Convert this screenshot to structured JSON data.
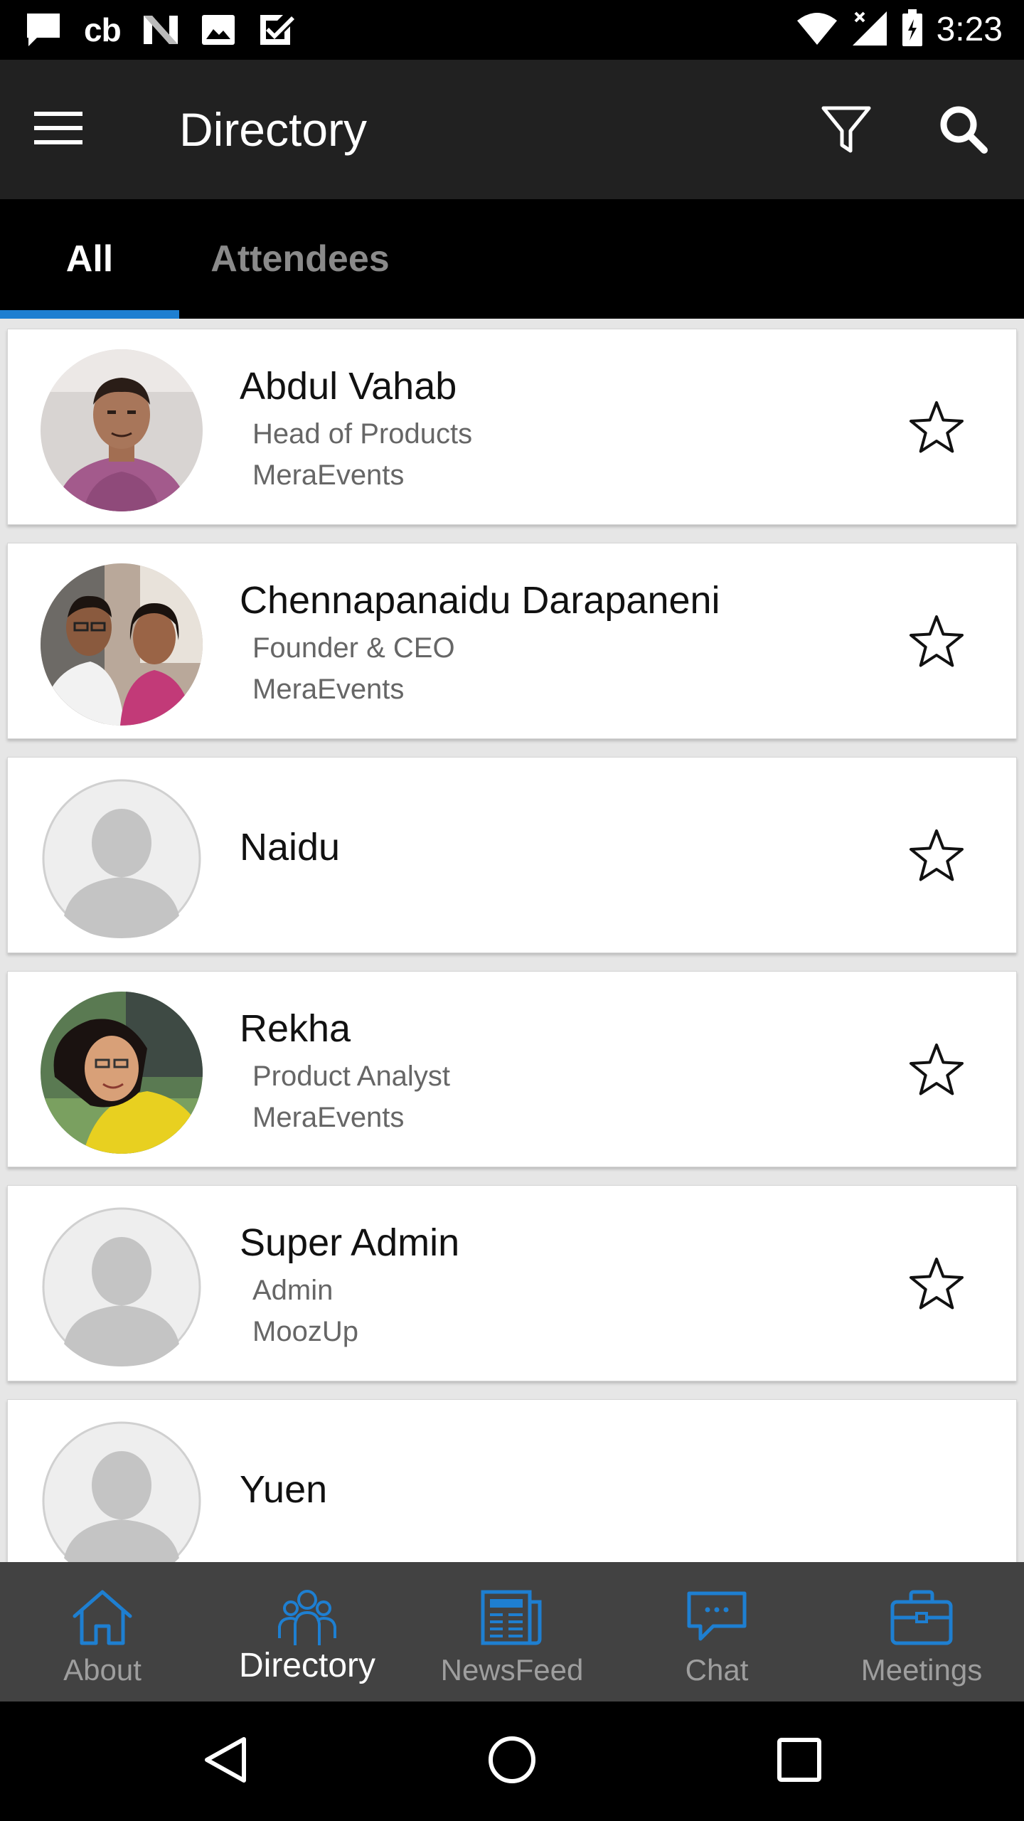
{
  "status_bar": {
    "time": "3:23",
    "left_icons": [
      "message-icon",
      "cb-icon",
      "n-icon",
      "image-icon",
      "check-icon"
    ],
    "right_icons": [
      "wifi-icon",
      "signal-icon",
      "battery-icon"
    ],
    "cb_text": "cb"
  },
  "app_bar": {
    "title": "Directory",
    "icons": [
      "menu-icon",
      "filter-icon",
      "search-icon"
    ]
  },
  "tabs": [
    {
      "label": "All",
      "active": true
    },
    {
      "label": "Attendees",
      "active": false
    }
  ],
  "accent_color": "#1e7fd1",
  "people": [
    {
      "name": "Abdul Vahab",
      "role": "Head of Products",
      "company": "MeraEvents",
      "avatar": "photo"
    },
    {
      "name": "Chennapanaidu Darapaneni",
      "role": "Founder & CEO",
      "company": "MeraEvents",
      "avatar": "photo"
    },
    {
      "name": "Naidu",
      "role": "",
      "company": "",
      "avatar": "placeholder"
    },
    {
      "name": "Rekha",
      "role": "Product Analyst",
      "company": "MeraEvents",
      "avatar": "photo"
    },
    {
      "name": "Super Admin",
      "role": "Admin",
      "company": "MoozUp",
      "avatar": "placeholder"
    },
    {
      "name": "Yuen",
      "role": "",
      "company": "",
      "avatar": "placeholder"
    }
  ],
  "bottom_nav": [
    {
      "label": "About",
      "icon": "home-icon",
      "active": false
    },
    {
      "label": "Directory",
      "icon": "people-icon",
      "active": true
    },
    {
      "label": "NewsFeed",
      "icon": "newspaper-icon",
      "active": false
    },
    {
      "label": "Chat",
      "icon": "chat-icon",
      "active": false
    },
    {
      "label": "Meetings",
      "icon": "briefcase-icon",
      "active": false
    }
  ],
  "system_nav": [
    "back-icon",
    "home-circle-icon",
    "recents-icon"
  ]
}
